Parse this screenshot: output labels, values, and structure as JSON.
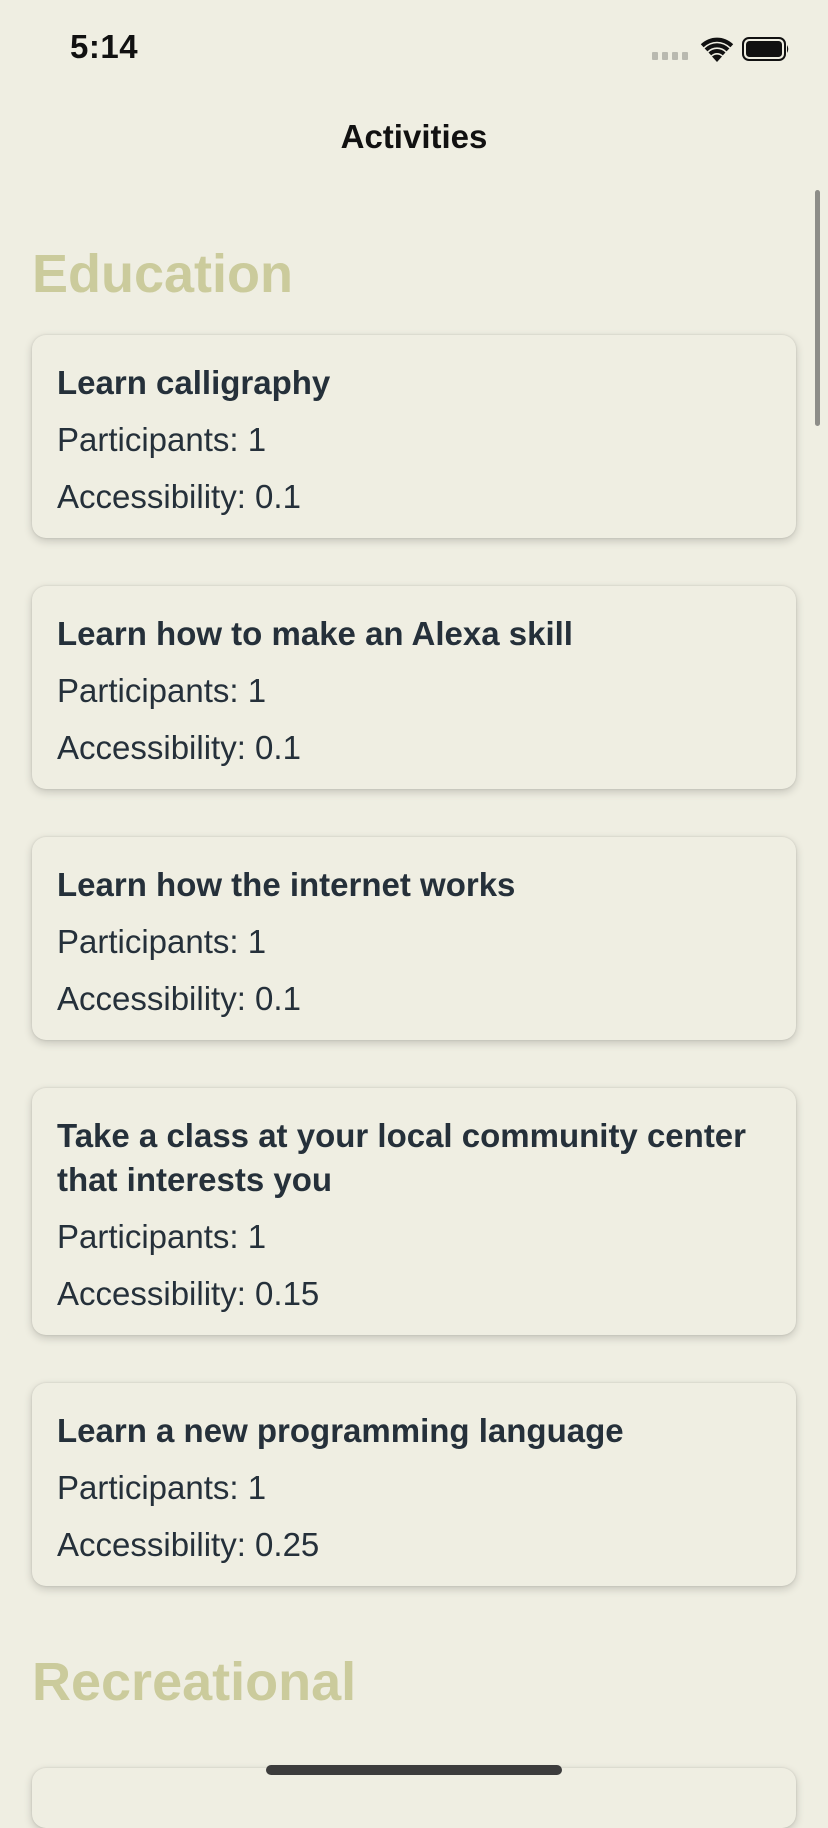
{
  "status": {
    "time": "5:14"
  },
  "nav": {
    "title": "Activities"
  },
  "sections": [
    {
      "title": "Education",
      "activities": [
        {
          "name": "Learn calligraphy",
          "participants": "Participants: 1",
          "accessibility": "Accessibility: 0.1"
        },
        {
          "name": "Learn how to make an Alexa skill",
          "participants": "Participants: 1",
          "accessibility": "Accessibility: 0.1"
        },
        {
          "name": "Learn how the internet works",
          "participants": "Participants: 1",
          "accessibility": "Accessibility: 0.1"
        },
        {
          "name": "Take a class at your local community center that interests you",
          "participants": "Participants: 1",
          "accessibility": "Accessibility: 0.15"
        },
        {
          "name": "Learn a new programming language",
          "participants": "Participants: 1",
          "accessibility": "Accessibility: 0.25"
        }
      ]
    },
    {
      "title": "Recreational"
    }
  ],
  "colors": {
    "background": "#EFEEE2",
    "section_title": "#CBCB9C",
    "card_text": "#25303A"
  },
  "icons": [
    "signal-icon",
    "wifi-icon",
    "battery-icon"
  ]
}
